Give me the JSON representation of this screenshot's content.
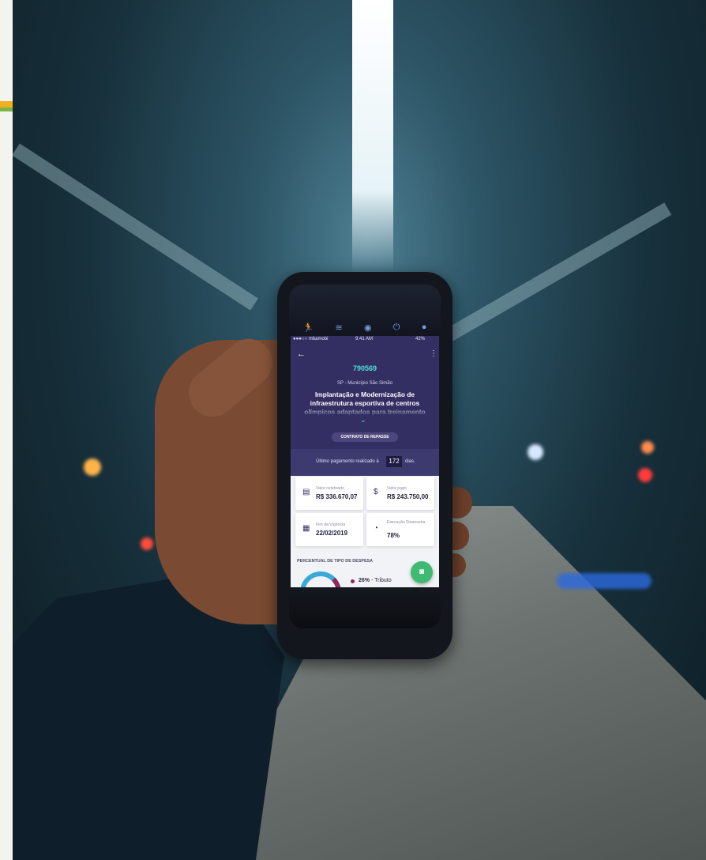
{
  "status_bar": {
    "carrier": "●●●○○ mbamobi",
    "time": "9:41 AM",
    "battery": "42%"
  },
  "app_icons": [
    "run-icon",
    "sleep-icon",
    "health-icon",
    "timer-icon",
    "water-icon"
  ],
  "header": {
    "contract_id": "790569",
    "location": "SP - Município São Simão",
    "title": "Implantação e Modernização de infraestrutura esportiva de centros olímpicos adaptados para treinamento",
    "repasse_label": "CONTRATO DE REPASSE"
  },
  "payment": {
    "prefix": "Último pagamento realizado à",
    "days": "172",
    "suffix": "dias."
  },
  "cards": [
    {
      "label": "Valor celebrado",
      "value": "R$ 336.670,07",
      "icon": "document-icon"
    },
    {
      "label": "Valor pago",
      "value": "R$ 243.750,00",
      "icon": "dollar-icon"
    },
    {
      "label": "Fim da Vigência",
      "value": "22/02/2019",
      "icon": "calendar-icon"
    },
    {
      "label": "Execução Financeira",
      "value": "78%",
      "icon": "progress-icon"
    }
  ],
  "expenses": {
    "section_title": "PERCENTUAL DE TIPO DE DESPESA",
    "legend": [
      {
        "percent": "26%",
        "label": "- Tributo"
      }
    ]
  },
  "colors": {
    "primary": "#332f63",
    "accent": "#4fe0d6",
    "fab": "#3fba71"
  }
}
